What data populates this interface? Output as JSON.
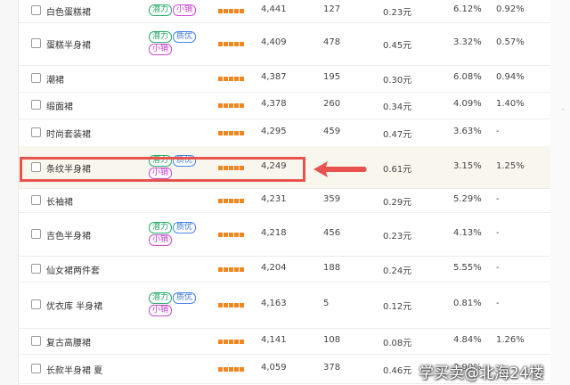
{
  "rows": [
    {
      "keyword": "白色蛋糕裙",
      "tags": [
        "潜力",
        "小销"
      ],
      "n1": "4,441",
      "n2": "127",
      "price": "0.23元",
      "p1": "6.12%",
      "p2": "0.92%"
    },
    {
      "keyword": "蛋糕半身裙",
      "tags": [
        "潜力",
        "质优",
        "小销"
      ],
      "n1": "4,409",
      "n2": "478",
      "price": "0.45元",
      "p1": "3.32%",
      "p2": "0.57%"
    },
    {
      "keyword": "潮裙",
      "tags": [],
      "n1": "4,387",
      "n2": "195",
      "price": "0.30元",
      "p1": "6.08%",
      "p2": "0.94%"
    },
    {
      "keyword": "缎面裙",
      "tags": [],
      "n1": "4,378",
      "n2": "260",
      "price": "0.34元",
      "p1": "4.09%",
      "p2": "1.40%"
    },
    {
      "keyword": "时尚套装裙",
      "tags": [],
      "n1": "4,295",
      "n2": "459",
      "price": "0.47元",
      "p1": "3.63%",
      "p2": "-"
    },
    {
      "keyword": "条纹半身裙",
      "tags": [
        "潜力",
        "质优",
        "小销"
      ],
      "n1": "4,249",
      "n2": "",
      "price": "0.61元",
      "p1": "3.15%",
      "p2": "1.25%"
    },
    {
      "keyword": "长袖裙",
      "tags": [],
      "n1": "4,231",
      "n2": "359",
      "price": "0.29元",
      "p1": "5.29%",
      "p2": "-"
    },
    {
      "keyword": "吉色半身裙",
      "tags": [
        "潜力",
        "质优",
        "小销"
      ],
      "n1": "4,218",
      "n2": "456",
      "price": "0.23元",
      "p1": "4.13%",
      "p2": "-"
    },
    {
      "keyword": "仙女裙两件套",
      "tags": [],
      "n1": "4,204",
      "n2": "188",
      "price": "0.24元",
      "p1": "5.55%",
      "p2": "-"
    },
    {
      "keyword": "优衣库 半身裙",
      "tags": [
        "潜力",
        "质优",
        "小销"
      ],
      "n1": "4,163",
      "n2": "5",
      "price": "0.12元",
      "p1": "0.81%",
      "p2": "-"
    },
    {
      "keyword": "复古高腰裙",
      "tags": [],
      "n1": "4,141",
      "n2": "108",
      "price": "0.08元",
      "p1": "4.84%",
      "p2": "1.26%"
    },
    {
      "keyword": "长款半身裙 夏",
      "tags": [],
      "n1": "4,059",
      "n2": "378",
      "price": "0.46元",
      "p1": "3.90%",
      "p2": "-"
    }
  ],
  "tag_colors": {
    "潜力": "#1aa05a",
    "质优": "#3b74d8",
    "小销": "#c032c8"
  },
  "stars_color": "#f0861f",
  "highlight_color": "#e8534d",
  "watermark": "学买卖@北海24楼"
}
